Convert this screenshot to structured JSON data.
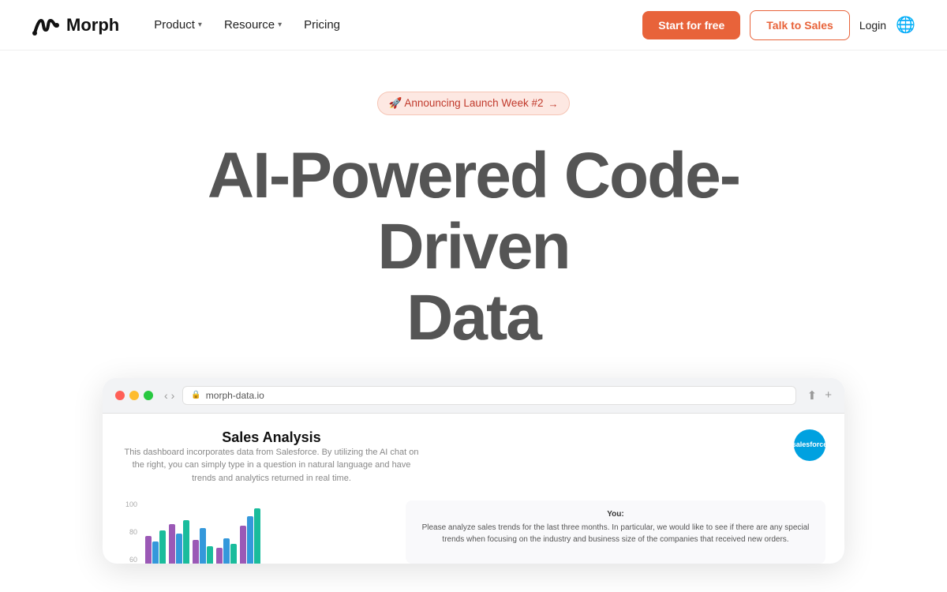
{
  "nav": {
    "logo_text": "Morph",
    "product_label": "Product",
    "resource_label": "Resource",
    "pricing_label": "Pricing",
    "start_label": "Start for free",
    "sales_label": "Talk to Sales",
    "login_label": "Login"
  },
  "hero": {
    "announce_text": "🚀 Announcing Launch Week #2",
    "announce_arrow": "→",
    "title_line1": "AI-Powered Code-Driven",
    "title_line2": "Data"
  },
  "browser": {
    "url": "morph-data.io",
    "dashboard_title": "Sales Analysis",
    "dashboard_desc": "This dashboard incorporates data from Salesforce. By utilizing the AI chat on the right, you can simply type in a question in natural language and have trends and analytics returned in real time.",
    "salesforce_label": "salesforce",
    "y_axis": [
      "100",
      "80",
      "60"
    ],
    "chat_label": "You:",
    "chat_text": "Please analyze sales trends for the last three months. In particular, we would like to see if there are any special trends when focusing on the industry and business size of the companies that received new orders."
  },
  "colors": {
    "accent": "#E8633A",
    "bar1": "#9b59b6",
    "bar2": "#3498db",
    "bar3": "#1abc9c"
  }
}
